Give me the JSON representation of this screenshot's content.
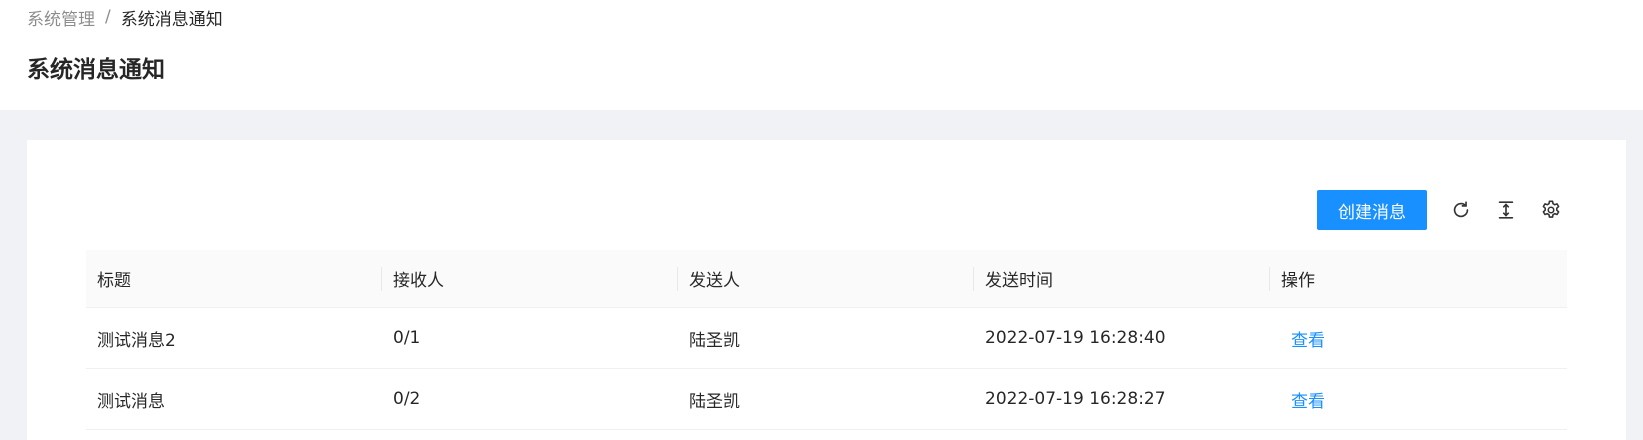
{
  "breadcrumb": {
    "parent": "系统管理",
    "separator": "/",
    "current": "系统消息通知"
  },
  "page": {
    "title": "系统消息通知"
  },
  "toolbar": {
    "create_label": "创建消息",
    "icons": [
      "reload-icon",
      "column-height-icon",
      "setting-icon"
    ]
  },
  "table": {
    "columns": [
      "标题",
      "接收人",
      "发送人",
      "发送时间",
      "操作"
    ],
    "rows": [
      {
        "title": "测试消息2",
        "receivers": "0/1",
        "sender": "陆圣凯",
        "time": "2022-07-19 16:28:40",
        "action": "查看"
      },
      {
        "title": "测试消息",
        "receivers": "0/2",
        "sender": "陆圣凯",
        "time": "2022-07-19 16:28:27",
        "action": "查看"
      }
    ]
  },
  "colors": {
    "primary": "#1890ff",
    "background": "#f0f2f5",
    "header_bg": "#fafafa"
  }
}
